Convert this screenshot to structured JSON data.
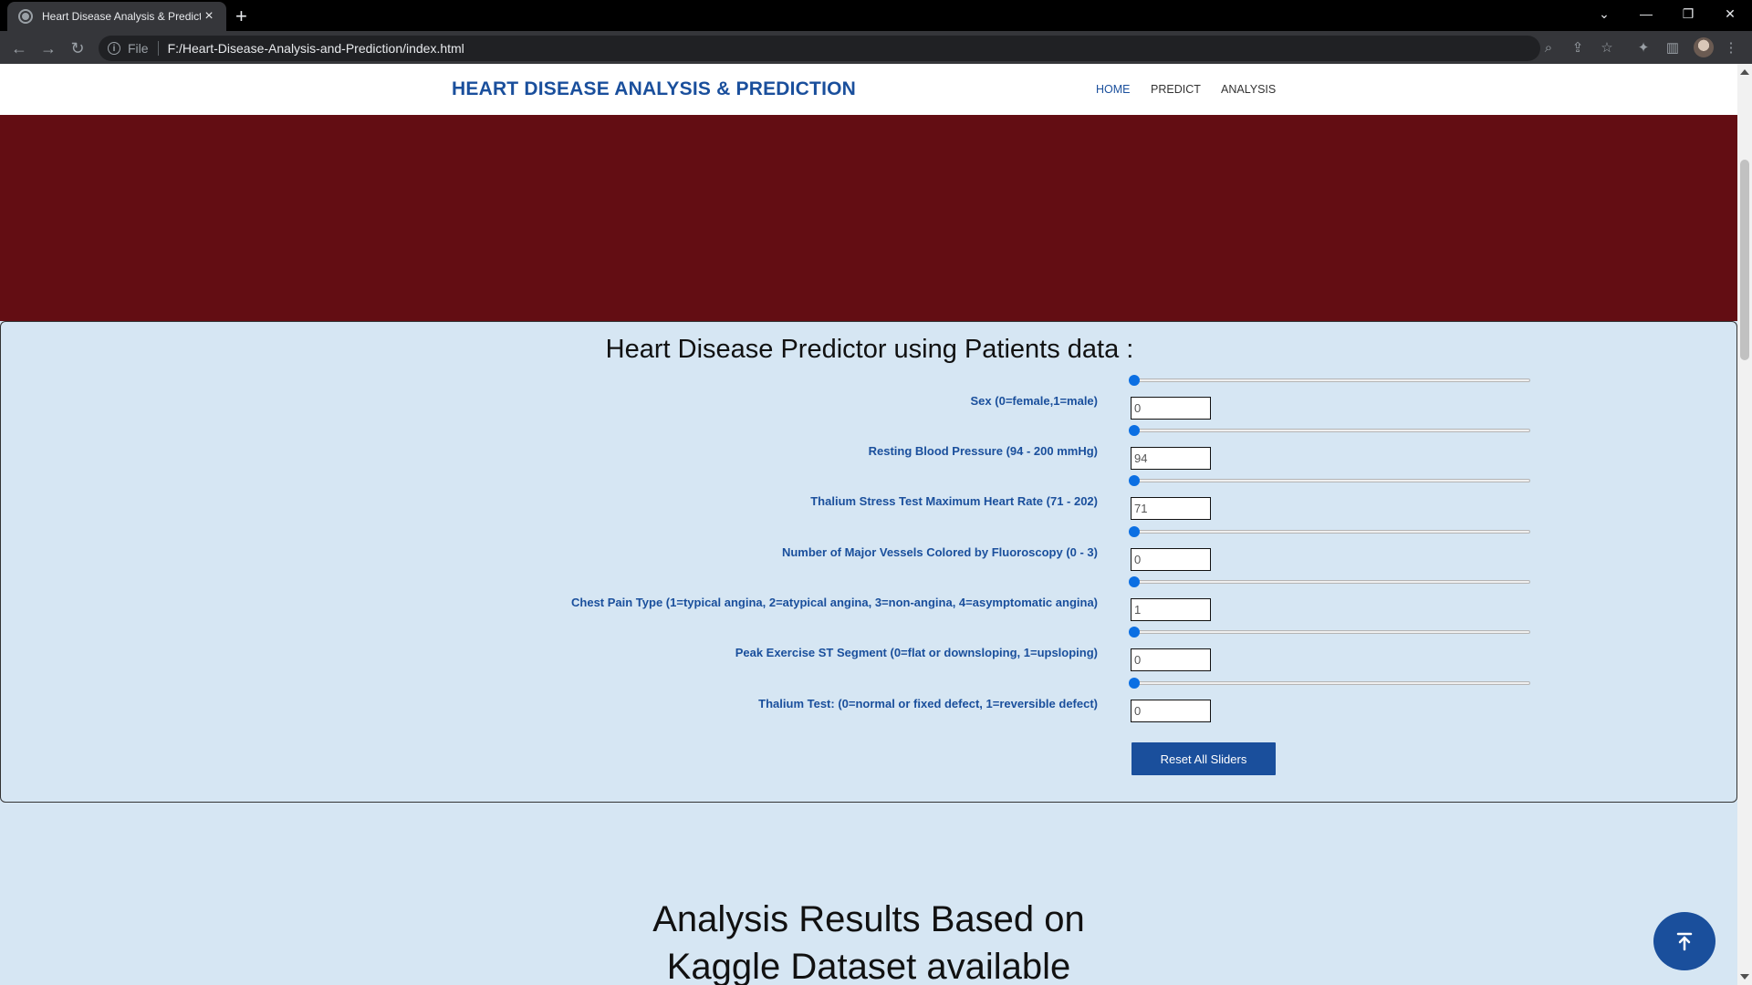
{
  "browser": {
    "tab_title": "Heart Disease Analysis & Predicti",
    "scheme": "File",
    "url": "F:/Heart-Disease-Analysis-and-Prediction/index.html"
  },
  "nav": {
    "brand": "HEART DISEASE ANALYSIS & PREDICTION",
    "links": [
      "HOME",
      "PREDICT",
      "ANALYSIS"
    ]
  },
  "predictor": {
    "heading": "Heart Disease Predictor using Patients data :",
    "fields": [
      {
        "label": "Sex (0=female,1=male)",
        "value": "0"
      },
      {
        "label": "Resting Blood Pressure (94 - 200 mmHg)",
        "value": "94"
      },
      {
        "label": "Thalium Stress Test Maximum Heart Rate (71 - 202)",
        "value": "71"
      },
      {
        "label": "Number of Major Vessels Colored by Fluoroscopy (0 - 3)",
        "value": "0"
      },
      {
        "label": "Chest Pain Type (1=typical angina, 2=atypical angina, 3=non-angina, 4=asymptomatic angina)",
        "value": "1"
      },
      {
        "label": "Peak Exercise ST Segment (0=flat or downsloping, 1=upsloping)",
        "value": "0"
      },
      {
        "label": "Thalium Test: (0=normal or fixed defect, 1=reversible defect)",
        "value": "0"
      }
    ],
    "reset_label": "Reset All Sliders"
  },
  "analysis": {
    "heading_line1": "Analysis Results Based on",
    "heading_line2": "Kaggle Dataset available"
  },
  "colors": {
    "brand_blue": "#1a4f9c",
    "hero_red": "#630d13",
    "page_bg": "#d6e6f3"
  }
}
